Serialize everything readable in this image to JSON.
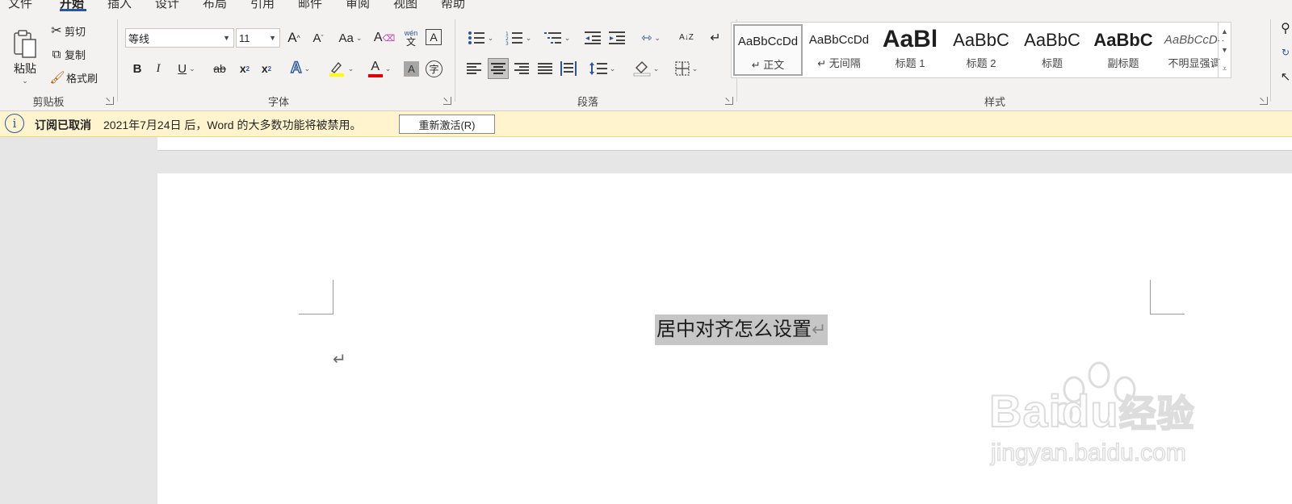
{
  "tabs": [
    "文件",
    "开始",
    "插入",
    "设计",
    "布局",
    "引用",
    "邮件",
    "审阅",
    "视图",
    "帮助"
  ],
  "clipboard": {
    "paste_label": "粘贴",
    "cut_label": "剪切",
    "copy_label": "复制",
    "format_painter_label": "格式刷",
    "group_label": "剪贴板"
  },
  "font": {
    "font_name": "等线",
    "font_size": "11",
    "grow_label": "A",
    "shrink_label": "A",
    "change_case_label": "Aa",
    "phonetic_label": "wén",
    "phonetic_sub": "文",
    "char_border_label": "A",
    "bold_label": "B",
    "italic_label": "I",
    "underline_label": "U",
    "strike_label": "ab",
    "subscript_label": "x",
    "superscript_label": "x",
    "text_effects_label": "A",
    "font_color_label": "A",
    "char_shading_label": "A",
    "enclose_label": "字",
    "group_label": "字体",
    "highlight_color": "#ffff00",
    "font_color": "#e00000"
  },
  "paragraph": {
    "group_label": "段落",
    "sort_label": "A↓Z"
  },
  "styles": {
    "group_label": "样式",
    "items": [
      {
        "sample": "AaBbCcDd",
        "name": "正文",
        "mark": "↵"
      },
      {
        "sample": "AaBbCcDd",
        "name": "无间隔",
        "mark": "↵"
      },
      {
        "sample": "AaBl",
        "name": "标题 1"
      },
      {
        "sample": "AaBbC",
        "name": "标题 2"
      },
      {
        "sample": "AaBbC",
        "name": "标题"
      },
      {
        "sample": "AaBbC",
        "name": "副标题"
      },
      {
        "sample": "AaBbCcDd",
        "name": "不明显强调"
      }
    ]
  },
  "message_bar": {
    "title": "订阅已取消",
    "text": "2021年7月24日 后，Word 的大多数功能将被禁用。",
    "button_label": "重新激活(R)"
  },
  "document": {
    "selected_text": "居中对齐怎么设置",
    "paragraph_mark": "↵"
  },
  "watermark": {
    "brand": "Baidu",
    "suffix": "经验",
    "url": "jingyan.baidu.com"
  },
  "colors": {
    "accent": "#2b579a",
    "ribbon_bg": "#f3f2f1",
    "message_bar_bg": "#fff4ce",
    "selection": "#c6c6c6"
  }
}
